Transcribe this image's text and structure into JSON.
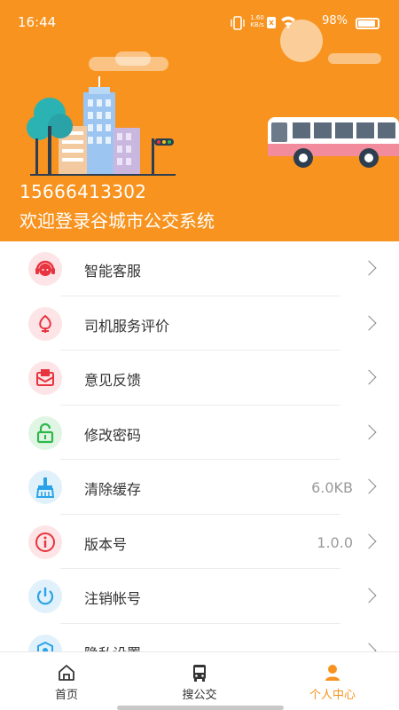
{
  "status_bar": {
    "time": "16:44",
    "net_speed": "1.60\nKB/s",
    "battery": "98%"
  },
  "profile": {
    "phone": "15666413302",
    "welcome": "欢迎登录谷城市公交系统"
  },
  "menu": [
    {
      "label": "智能客服",
      "value": "",
      "icon": "headset-icon",
      "color": "#E8343F"
    },
    {
      "label": "司机服务评价",
      "value": "",
      "icon": "flower-icon",
      "color": "#E8343F"
    },
    {
      "label": "意见反馈",
      "value": "",
      "icon": "mail-icon",
      "color": "#E8343F"
    },
    {
      "label": "修改密码",
      "value": "",
      "icon": "unlock-icon",
      "color": "#2DB84A"
    },
    {
      "label": "清除缓存",
      "value": "6.0KB",
      "icon": "broom-icon",
      "color": "#29A3E8"
    },
    {
      "label": "版本号",
      "value": "1.0.0",
      "icon": "info-icon",
      "color": "#E8343F"
    },
    {
      "label": "注销帐号",
      "value": "",
      "icon": "power-icon",
      "color": "#29A3E8"
    },
    {
      "label": "隐私设置",
      "value": "",
      "icon": "shield-icon",
      "color": "#29A3E8"
    }
  ],
  "bottom_nav": [
    {
      "label": "首页",
      "icon": "home-icon",
      "active": false
    },
    {
      "label": "搜公交",
      "icon": "bus-icon",
      "active": false
    },
    {
      "label": "个人中心",
      "icon": "person-icon",
      "active": true
    }
  ],
  "colors": {
    "accent": "#F7931E",
    "text": "#333333",
    "secondary": "#999999"
  }
}
